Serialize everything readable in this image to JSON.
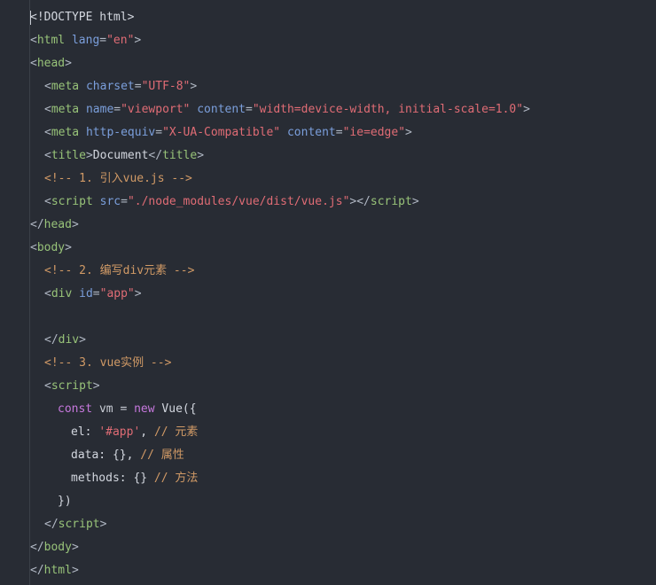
{
  "editor": {
    "lines": [
      {
        "indent": 0,
        "tokens": [
          {
            "t": "<!DOCTYPE html>",
            "c": "text"
          }
        ]
      },
      {
        "indent": 0,
        "tokens": [
          {
            "t": "<",
            "c": "punc"
          },
          {
            "t": "html",
            "c": "tag"
          },
          {
            "t": " ",
            "c": "text"
          },
          {
            "t": "lang",
            "c": "attr"
          },
          {
            "t": "=",
            "c": "punc"
          },
          {
            "t": "\"en\"",
            "c": "str"
          },
          {
            "t": ">",
            "c": "punc"
          }
        ]
      },
      {
        "indent": 0,
        "tokens": [
          {
            "t": "<",
            "c": "punc"
          },
          {
            "t": "head",
            "c": "tag"
          },
          {
            "t": ">",
            "c": "punc"
          }
        ]
      },
      {
        "indent": 1,
        "tokens": [
          {
            "t": "<",
            "c": "punc"
          },
          {
            "t": "meta",
            "c": "tag"
          },
          {
            "t": " ",
            "c": "text"
          },
          {
            "t": "charset",
            "c": "attr"
          },
          {
            "t": "=",
            "c": "punc"
          },
          {
            "t": "\"UTF-8\"",
            "c": "str"
          },
          {
            "t": ">",
            "c": "punc"
          }
        ]
      },
      {
        "indent": 1,
        "tokens": [
          {
            "t": "<",
            "c": "punc"
          },
          {
            "t": "meta",
            "c": "tag"
          },
          {
            "t": " ",
            "c": "text"
          },
          {
            "t": "name",
            "c": "attr"
          },
          {
            "t": "=",
            "c": "punc"
          },
          {
            "t": "\"viewport\"",
            "c": "str"
          },
          {
            "t": " ",
            "c": "text"
          },
          {
            "t": "content",
            "c": "attr"
          },
          {
            "t": "=",
            "c": "punc"
          },
          {
            "t": "\"width=device-width, initial-scale=1.0\"",
            "c": "str"
          },
          {
            "t": ">",
            "c": "punc"
          }
        ]
      },
      {
        "indent": 1,
        "tokens": [
          {
            "t": "<",
            "c": "punc"
          },
          {
            "t": "meta",
            "c": "tag"
          },
          {
            "t": " ",
            "c": "text"
          },
          {
            "t": "http-equiv",
            "c": "attr"
          },
          {
            "t": "=",
            "c": "punc"
          },
          {
            "t": "\"X-UA-Compatible\"",
            "c": "str"
          },
          {
            "t": " ",
            "c": "text"
          },
          {
            "t": "content",
            "c": "attr"
          },
          {
            "t": "=",
            "c": "punc"
          },
          {
            "t": "\"ie=edge\"",
            "c": "str"
          },
          {
            "t": ">",
            "c": "punc"
          }
        ]
      },
      {
        "indent": 1,
        "tokens": [
          {
            "t": "<",
            "c": "punc"
          },
          {
            "t": "title",
            "c": "tag"
          },
          {
            "t": ">",
            "c": "punc"
          },
          {
            "t": "Document",
            "c": "text"
          },
          {
            "t": "</",
            "c": "punc"
          },
          {
            "t": "title",
            "c": "tag"
          },
          {
            "t": ">",
            "c": "punc"
          }
        ]
      },
      {
        "indent": 1,
        "tokens": [
          {
            "t": "<!-- 1. 引入vue.js -->",
            "c": "comment"
          }
        ]
      },
      {
        "indent": 1,
        "tokens": [
          {
            "t": "<",
            "c": "punc"
          },
          {
            "t": "script",
            "c": "tag"
          },
          {
            "t": " ",
            "c": "text"
          },
          {
            "t": "src",
            "c": "attr"
          },
          {
            "t": "=",
            "c": "punc"
          },
          {
            "t": "\"./node_modules/vue/dist/vue.js\"",
            "c": "str"
          },
          {
            "t": ">",
            "c": "punc"
          },
          {
            "t": "</",
            "c": "punc"
          },
          {
            "t": "script",
            "c": "tag"
          },
          {
            "t": ">",
            "c": "punc"
          }
        ]
      },
      {
        "indent": 0,
        "tokens": [
          {
            "t": "</",
            "c": "punc"
          },
          {
            "t": "head",
            "c": "tag"
          },
          {
            "t": ">",
            "c": "punc"
          }
        ]
      },
      {
        "indent": 0,
        "tokens": [
          {
            "t": "<",
            "c": "punc"
          },
          {
            "t": "body",
            "c": "tag"
          },
          {
            "t": ">",
            "c": "punc"
          }
        ]
      },
      {
        "indent": 1,
        "tokens": [
          {
            "t": "<!-- 2. 编写div元素 -->",
            "c": "comment"
          }
        ]
      },
      {
        "indent": 1,
        "tokens": [
          {
            "t": "<",
            "c": "punc"
          },
          {
            "t": "div",
            "c": "tag"
          },
          {
            "t": " ",
            "c": "text"
          },
          {
            "t": "id",
            "c": "attr"
          },
          {
            "t": "=",
            "c": "punc"
          },
          {
            "t": "\"app\"",
            "c": "str"
          },
          {
            "t": ">",
            "c": "punc"
          }
        ]
      },
      {
        "indent": 0,
        "tokens": []
      },
      {
        "indent": 1,
        "tokens": [
          {
            "t": "</",
            "c": "punc"
          },
          {
            "t": "div",
            "c": "tag"
          },
          {
            "t": ">",
            "c": "punc"
          }
        ]
      },
      {
        "indent": 1,
        "tokens": [
          {
            "t": "<!-- 3. vue实例 -->",
            "c": "comment"
          }
        ]
      },
      {
        "indent": 1,
        "tokens": [
          {
            "t": "<",
            "c": "punc"
          },
          {
            "t": "script",
            "c": "tag"
          },
          {
            "t": ">",
            "c": "punc"
          }
        ]
      },
      {
        "indent": 2,
        "tokens": [
          {
            "t": "const",
            "c": "key"
          },
          {
            "t": " ",
            "c": "text"
          },
          {
            "t": "vm",
            "c": "var"
          },
          {
            "t": " = ",
            "c": "op"
          },
          {
            "t": "new",
            "c": "key"
          },
          {
            "t": " ",
            "c": "text"
          },
          {
            "t": "Vue({",
            "c": "text"
          }
        ]
      },
      {
        "indent": 3,
        "tokens": [
          {
            "t": "el: ",
            "c": "text"
          },
          {
            "t": "'#app'",
            "c": "str"
          },
          {
            "t": ", ",
            "c": "text"
          },
          {
            "t": "// 元素",
            "c": "comment"
          }
        ]
      },
      {
        "indent": 3,
        "tokens": [
          {
            "t": "data: {}, ",
            "c": "text"
          },
          {
            "t": "// 属性",
            "c": "comment"
          }
        ]
      },
      {
        "indent": 3,
        "tokens": [
          {
            "t": "methods: {} ",
            "c": "text"
          },
          {
            "t": "// 方法",
            "c": "comment"
          }
        ]
      },
      {
        "indent": 2,
        "tokens": [
          {
            "t": "})",
            "c": "text"
          }
        ]
      },
      {
        "indent": 1,
        "tokens": [
          {
            "t": "</",
            "c": "punc"
          },
          {
            "t": "script",
            "c": "tag"
          },
          {
            "t": ">",
            "c": "punc"
          }
        ]
      },
      {
        "indent": 0,
        "tokens": [
          {
            "t": "</",
            "c": "punc"
          },
          {
            "t": "body",
            "c": "tag"
          },
          {
            "t": ">",
            "c": "punc"
          }
        ]
      },
      {
        "indent": 0,
        "tokens": [
          {
            "t": "</",
            "c": "punc"
          },
          {
            "t": "html",
            "c": "tag"
          },
          {
            "t": ">",
            "c": "punc"
          }
        ]
      }
    ]
  },
  "colors": {
    "background": "#282c34",
    "tag": "#98c379",
    "attribute": "#7b9fdc",
    "string": "#e06c75",
    "comment": "#d19a66",
    "keyword": "#c678dd",
    "text": "#d3d7df"
  }
}
